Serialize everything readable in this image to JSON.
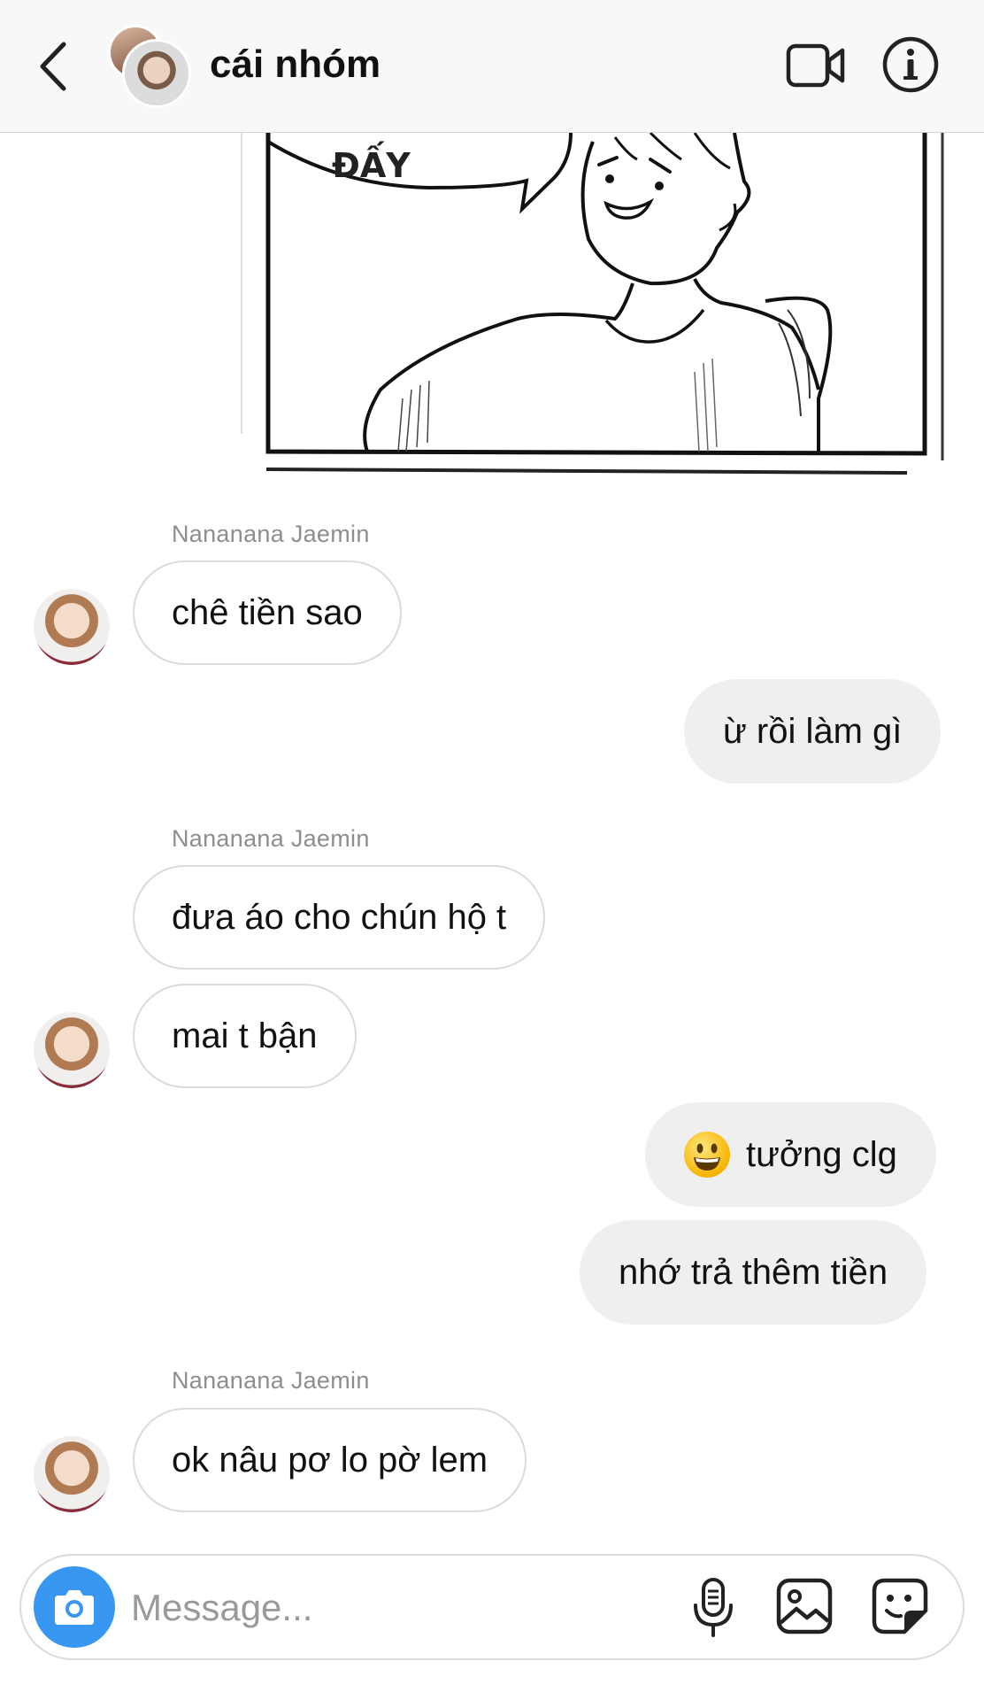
{
  "header": {
    "title": "cái nhóm",
    "icons": {
      "back": "chevron-left-icon",
      "video": "video-camera-icon",
      "info": "info-icon"
    }
  },
  "comic": {
    "caption_text": "ĐẤY"
  },
  "messages": [
    {
      "sender": "Nananana Jaemin",
      "text": "chê tiền sao",
      "direction": "incoming"
    },
    {
      "text": "ừ rồi làm gì",
      "direction": "outgoing"
    },
    {
      "sender": "Nananana Jaemin",
      "text": "đưa áo cho chún hộ t",
      "direction": "incoming"
    },
    {
      "text": "mai t bận",
      "direction": "incoming"
    },
    {
      "text": "tưởng clg",
      "direction": "outgoing",
      "emoji": "grinning-face-emoji"
    },
    {
      "text": "nhớ trả thêm tiền",
      "direction": "outgoing"
    },
    {
      "sender": "Nananana Jaemin",
      "text": "ok nâu pơ lo pờ lem",
      "direction": "incoming"
    }
  ],
  "composer": {
    "placeholder": "Message...",
    "icons": [
      "camera-icon",
      "microphone-icon",
      "gallery-icon",
      "sticker-icon"
    ]
  },
  "colors": {
    "accent": "#3897f0",
    "outgoing_bubble": "#efefef",
    "incoming_border": "#dbdbdb",
    "meta_text": "#8e8e8e"
  }
}
